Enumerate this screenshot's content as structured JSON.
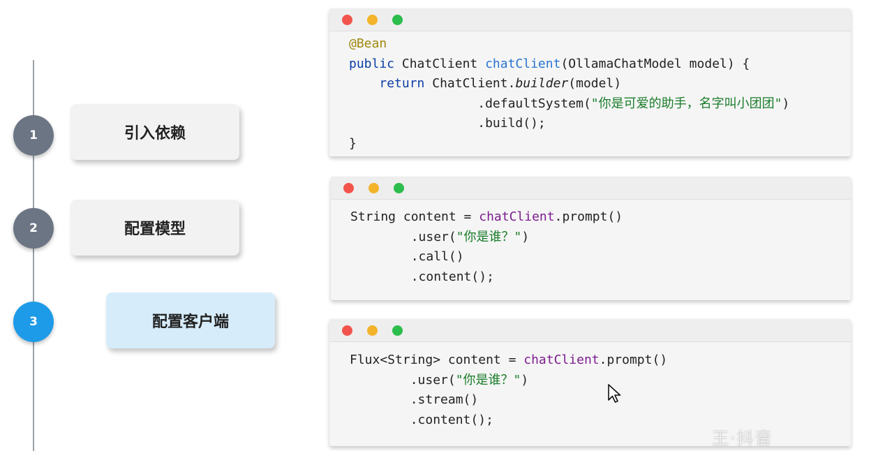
{
  "steps": [
    {
      "number": "1",
      "label": "引入依赖",
      "active": false
    },
    {
      "number": "2",
      "label": "配置模型",
      "active": false
    },
    {
      "number": "3",
      "label": "配置客户端",
      "active": true
    }
  ],
  "code_windows": [
    {
      "lines": [
        {
          "tokens": [
            {
              "t": "@Bean",
              "c": "ann"
            }
          ]
        },
        {
          "tokens": [
            {
              "t": "public",
              "c": "kw"
            },
            {
              "t": " ChatClient "
            },
            {
              "t": "chatClient",
              "c": "fn"
            },
            {
              "t": "(OllamaChatModel model) {"
            }
          ]
        },
        {
          "tokens": [
            {
              "t": "    "
            },
            {
              "t": "return",
              "c": "kw"
            },
            {
              "t": " ChatClient."
            },
            {
              "t": "builder",
              "c": "it"
            },
            {
              "t": "(model)"
            }
          ]
        },
        {
          "tokens": [
            {
              "t": "                 .defaultSystem("
            },
            {
              "t": "\"你是可爱的助手，名字叫小团团\"",
              "c": "str"
            },
            {
              "t": ")"
            }
          ]
        },
        {
          "tokens": [
            {
              "t": "                 .build();"
            }
          ]
        },
        {
          "tokens": [
            {
              "t": "}"
            }
          ]
        }
      ]
    },
    {
      "lines": [
        {
          "tokens": [
            {
              "t": "String content = "
            },
            {
              "t": "chatClient",
              "c": "call"
            },
            {
              "t": ".prompt()"
            }
          ]
        },
        {
          "tokens": [
            {
              "t": "        .user("
            },
            {
              "t": "\"你是谁？\"",
              "c": "str"
            },
            {
              "t": ")"
            }
          ]
        },
        {
          "tokens": [
            {
              "t": "        .call()"
            }
          ]
        },
        {
          "tokens": [
            {
              "t": "        .content();"
            }
          ]
        }
      ]
    },
    {
      "lines": [
        {
          "tokens": [
            {
              "t": "Flux<String> content = "
            },
            {
              "t": "chatClient",
              "c": "call"
            },
            {
              "t": ".prompt()"
            }
          ]
        },
        {
          "tokens": [
            {
              "t": "        .user("
            },
            {
              "t": "\"你是谁？\"",
              "c": "str"
            },
            {
              "t": ")"
            }
          ]
        },
        {
          "tokens": [
            {
              "t": "        .stream()"
            }
          ]
        },
        {
          "tokens": [
            {
              "t": "        .content();"
            }
          ]
        }
      ]
    }
  ],
  "watermark": "王·抖音"
}
